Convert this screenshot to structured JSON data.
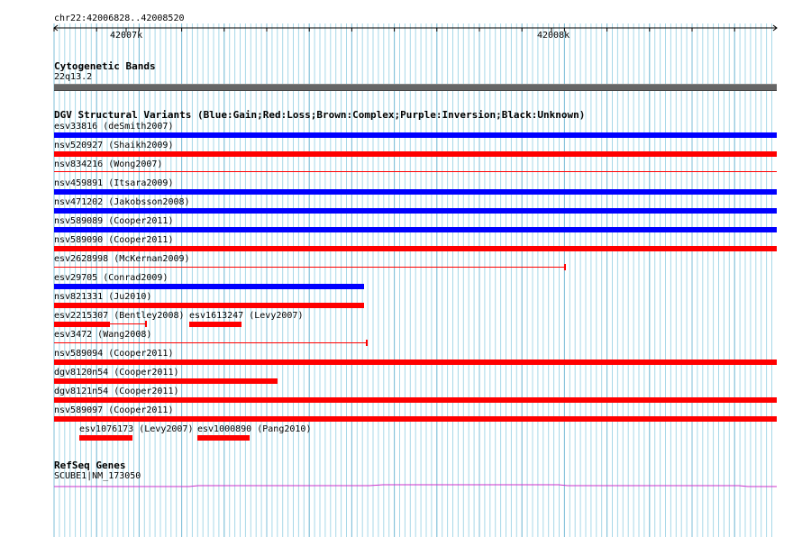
{
  "ruler": {
    "position": "chr22:42006828..42008520",
    "ticks": [
      "42007k",
      "42008k"
    ]
  },
  "cytoband": {
    "title": "Cytogenetic Bands",
    "band": "22q13.2",
    "color": "#666666"
  },
  "dgv": {
    "title": "DGV Structural Variants (Blue:Gain;Red:Loss;Brown:Complex;Purple:Inversion;Black:Unknown)",
    "colors": {
      "gain": "#0000ff",
      "loss": "#ff0000"
    },
    "rows": [
      {
        "items": [
          {
            "id": "esv33816",
            "study": "deSmith2007",
            "type": "gain",
            "style": "thick"
          }
        ]
      },
      {
        "items": [
          {
            "id": "nsv520927",
            "study": "Shaikh2009",
            "type": "loss",
            "style": "thick"
          }
        ]
      },
      {
        "items": [
          {
            "id": "nsv834216",
            "study": "Wong2007",
            "type": "loss",
            "style": "thin"
          }
        ]
      },
      {
        "items": [
          {
            "id": "nsv459891",
            "study": "Itsara2009",
            "type": "gain",
            "style": "thick"
          }
        ]
      },
      {
        "items": [
          {
            "id": "nsv471202",
            "study": "Jakobsson2008",
            "type": "gain",
            "style": "thick"
          }
        ]
      },
      {
        "items": [
          {
            "id": "nsv589089",
            "study": "Cooper2011",
            "type": "gain",
            "style": "thick"
          }
        ]
      },
      {
        "items": [
          {
            "id": "nsv589090",
            "study": "Cooper2011",
            "type": "loss",
            "style": "thick"
          }
        ]
      },
      {
        "items": [
          {
            "id": "esv2628998",
            "study": "McKernan2009",
            "type": "loss",
            "style": "thin"
          }
        ]
      },
      {
        "items": [
          {
            "id": "esv29705",
            "study": "Conrad2009",
            "type": "gain",
            "style": "thick"
          }
        ]
      },
      {
        "items": [
          {
            "id": "nsv821331",
            "study": "Ju2010",
            "type": "loss",
            "style": "thick"
          }
        ]
      },
      {
        "items": [
          {
            "id": "esv2215307",
            "study": "Bentley2008",
            "type": "loss",
            "style": "split"
          },
          {
            "id": "esv1613247",
            "study": "Levy2007",
            "type": "loss",
            "style": "thick"
          }
        ]
      },
      {
        "items": [
          {
            "id": "esv3472",
            "study": "Wang2008",
            "type": "loss",
            "style": "thin"
          }
        ]
      },
      {
        "items": [
          {
            "id": "nsv589094",
            "study": "Cooper2011",
            "type": "loss",
            "style": "thick"
          }
        ]
      },
      {
        "items": [
          {
            "id": "dgv8120n54",
            "study": "Cooper2011",
            "type": "loss",
            "style": "thick"
          }
        ]
      },
      {
        "items": [
          {
            "id": "dgv8121n54",
            "study": "Cooper2011",
            "type": "loss",
            "style": "thick"
          }
        ]
      },
      {
        "items": [
          {
            "id": "nsv589097",
            "study": "Cooper2011",
            "type": "loss",
            "style": "thick"
          }
        ]
      },
      {
        "items": [
          {
            "id": "esv1076173",
            "study": "Levy2007",
            "type": "loss",
            "style": "thick"
          },
          {
            "id": "esv1000890",
            "study": "Pang2010",
            "type": "loss",
            "style": "thick"
          }
        ]
      }
    ]
  },
  "refseq": {
    "title": "RefSeq Genes",
    "gene": "SCUBE1|NM_173050",
    "color": "#cc33cc"
  }
}
